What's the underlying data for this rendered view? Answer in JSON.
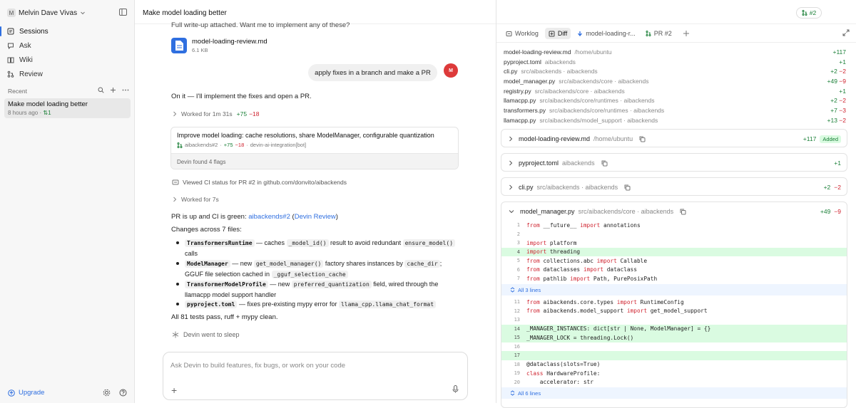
{
  "sidebar": {
    "workspace_initial": "M",
    "workspace_name": "Melvin Dave Vivas",
    "nav": [
      {
        "label": "Sessions",
        "icon": "sessions-icon"
      },
      {
        "label": "Ask",
        "icon": "ask-icon"
      },
      {
        "label": "Wiki",
        "icon": "wiki-icon"
      },
      {
        "label": "Review",
        "icon": "review-icon"
      }
    ],
    "recent_label": "Recent",
    "session": {
      "title": "Make model loading better",
      "time": "8 hours ago",
      "pr_count": "1"
    },
    "upgrade_label": "Upgrade"
  },
  "chat": {
    "title": "Make model loading better",
    "intro": "Full write-up attached. Want me to implement any of these?",
    "attachment": {
      "name": "model-loading-review.md",
      "size": "6.1 KB"
    },
    "user_message": "apply fixes in a branch and make a PR",
    "user_initial": "M",
    "reply1": "On it — I'll implement the fixes and open a PR.",
    "worked1": {
      "label": "Worked for 1m 31s",
      "add": "+75",
      "del": "−18"
    },
    "pr_card": {
      "title": "Improve model loading: cache resolutions, share ModelManager, configurable quantization",
      "repo": "aibackends#2",
      "add": "+75",
      "del": "−18",
      "bot": "devin-ai-integration[bot]",
      "flags": "Devin found 4 flags"
    },
    "ci_status": "Viewed CI status for PR #2 in github.com/donvito/aibackends",
    "worked2": "Worked for 7s",
    "pr_up_prefix": "PR is up and CI is green: ",
    "pr_link": "aibackends#2",
    "review_link": "Devin Review",
    "changes_header": "Changes across 7 files:",
    "bullets": [
      {
        "code": "TransformersRuntime",
        "t1": " — caches ",
        "c1": "_model_id()",
        "t2": " result to avoid redundant ",
        "c2": "ensure_model()",
        "t3": "calls"
      },
      {
        "code": "ModelManager",
        "t1": " — new ",
        "c1": "get_model_manager()",
        "t2": " factory shares instances by ",
        "c2": "cache_dir",
        "t3": ";",
        "t4": "GGUF file selection cached in ",
        "c3": "_gguf_selection_cache"
      },
      {
        "code": "TransformerModelProfile",
        "t1": " — new ",
        "c1": "preferred_quantization",
        "t2": " field, wired through the",
        "t3": "llamacpp model support handler"
      },
      {
        "code": "pyproject.toml",
        "t1": " — fixes pre-existing mypy error for ",
        "c1": "llama_cpp.llama_chat_format"
      }
    ],
    "tests": "All 81 tests pass, ruff + mypy clean.",
    "sleep": "Devin went to sleep",
    "composer_placeholder": "Ask Devin to build features, fix bugs, or work on your code"
  },
  "right": {
    "pr_badge": "#2",
    "tabs": [
      {
        "label": "Worklog",
        "icon": "worklog-icon"
      },
      {
        "label": "Diff",
        "icon": "diff-icon"
      },
      {
        "label": "model-loading-r...",
        "icon": "branch-icon"
      },
      {
        "label": "PR #2",
        "icon": "pr-icon"
      }
    ],
    "summary": [
      {
        "name": "model-loading-review.md",
        "path": "/home/ubuntu",
        "add": "+117",
        "del": ""
      },
      {
        "name": "pyproject.toml",
        "path": "aibackends",
        "add": "+1",
        "del": ""
      },
      {
        "name": "cli.py",
        "path": "src/aibackends · aibackends",
        "add": "+2",
        "del": "−2"
      },
      {
        "name": "model_manager.py",
        "path": "src/aibackends/core · aibackends",
        "add": "+49",
        "del": "−9"
      },
      {
        "name": "registry.py",
        "path": "src/aibackends/core · aibackends",
        "add": "+1",
        "del": ""
      },
      {
        "name": "llamacpp.py",
        "path": "src/aibackends/core/runtimes · aibackends",
        "add": "+2",
        "del": "−2"
      },
      {
        "name": "transformers.py",
        "path": "src/aibackends/core/runtimes · aibackends",
        "add": "+7",
        "del": "−3"
      },
      {
        "name": "llamacpp.py",
        "path": "src/aibackends/model_support · aibackends",
        "add": "+13",
        "del": "−2"
      }
    ],
    "files": [
      {
        "name": "model-loading-review.md",
        "path": "/home/ubuntu",
        "add": "+117",
        "del": "",
        "badge": "Added"
      },
      {
        "name": "pyproject.toml",
        "path": "aibackends",
        "add": "+1",
        "del": "",
        "badge": ""
      },
      {
        "name": "cli.py",
        "path": "src/aibackends · aibackends",
        "add": "+2",
        "del": "−2",
        "badge": ""
      },
      {
        "name": "model_manager.py",
        "path": "src/aibackends/core · aibackends",
        "add": "+49",
        "del": "−9",
        "badge": ""
      }
    ],
    "code_lines": [
      {
        "n": "1",
        "t": "from __future__ import annotations",
        "add": false
      },
      {
        "n": "2",
        "t": "",
        "add": false
      },
      {
        "n": "3",
        "t": "import platform",
        "add": false
      },
      {
        "n": "4",
        "t": "import threading",
        "add": true
      },
      {
        "n": "5",
        "t": "from collections.abc import Callable",
        "add": false
      },
      {
        "n": "6",
        "t": "from dataclasses import dataclass",
        "add": false
      },
      {
        "n": "7",
        "t": "from pathlib import Path, PurePosixPath",
        "add": false
      }
    ],
    "expand1": "All 3 lines",
    "code_lines2": [
      {
        "n": "11",
        "t": "from aibackends.core.types import RuntimeConfig",
        "add": false
      },
      {
        "n": "12",
        "t": "from aibackends.model_support import get_model_support",
        "add": false
      },
      {
        "n": "13",
        "t": "",
        "add": false
      },
      {
        "n": "14",
        "t": "_MANAGER_INSTANCES: dict[str | None, ModelManager] = {}",
        "add": true
      },
      {
        "n": "15",
        "t": "_MANAGER_LOCK = threading.Lock()",
        "add": true
      },
      {
        "n": "16",
        "t": "",
        "add": false
      },
      {
        "n": "17",
        "t": "",
        "add": true
      },
      {
        "n": "18",
        "t": "@dataclass(slots=True)",
        "add": false
      },
      {
        "n": "19",
        "t": "class HardwareProfile:",
        "add": false
      },
      {
        "n": "20",
        "t": "    accelerator: str",
        "add": false
      }
    ],
    "expand2": "All 6 lines"
  }
}
